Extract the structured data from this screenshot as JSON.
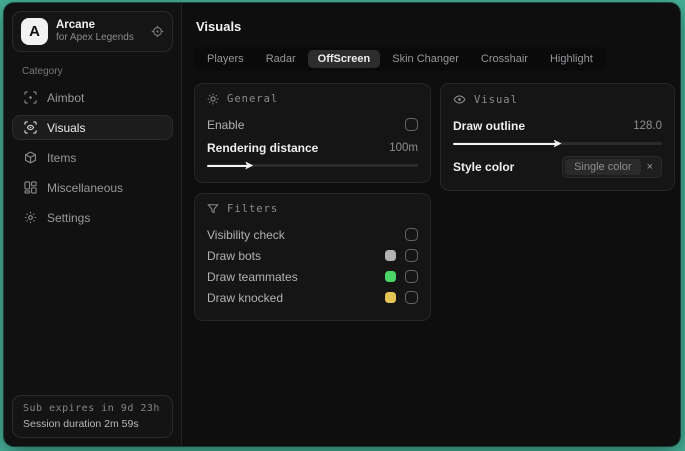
{
  "app": {
    "logo_letter": "A",
    "name": "Arcane",
    "subtitle": "for Apex Legends"
  },
  "sidebar": {
    "category_label": "Category",
    "items": [
      {
        "label": "Aimbot",
        "icon": "crosshair-scan-icon",
        "selected": false
      },
      {
        "label": "Visuals",
        "icon": "eye-scan-icon",
        "selected": true
      },
      {
        "label": "Items",
        "icon": "cube-icon",
        "selected": false
      },
      {
        "label": "Miscellaneous",
        "icon": "grid-icon",
        "selected": false
      },
      {
        "label": "Settings",
        "icon": "gear-icon",
        "selected": false
      }
    ],
    "status": {
      "sub_expires": "Sub expires in 9d 23h",
      "session_duration": "Session duration 2m 59s"
    }
  },
  "main": {
    "title": "Visuals",
    "tabs": [
      {
        "label": "Players",
        "selected": false
      },
      {
        "label": "Radar",
        "selected": false
      },
      {
        "label": "OffScreen",
        "selected": true
      },
      {
        "label": "Skin Changer",
        "selected": false
      },
      {
        "label": "Crosshair",
        "selected": false
      },
      {
        "label": "Highlight",
        "selected": false
      }
    ],
    "general": {
      "title": "General",
      "enable_label": "Enable",
      "rendering_distance_label": "Rendering distance",
      "rendering_distance_value": "100m",
      "rendering_distance_percent": 20
    },
    "visual": {
      "title": "Visual",
      "draw_outline_label": "Draw outline",
      "draw_outline_value": "128.0",
      "draw_outline_percent": 50,
      "style_color_label": "Style color",
      "style_color_chip": "Single color",
      "chip_close": "×"
    },
    "filters": {
      "title": "Filters",
      "rows": [
        {
          "label": "Visibility check",
          "swatch": null
        },
        {
          "label": "Draw bots",
          "swatch": "#b3b3b3"
        },
        {
          "label": "Draw teammates",
          "swatch": "#4bd567"
        },
        {
          "label": "Draw knocked",
          "swatch": "#e2c554"
        }
      ]
    }
  },
  "colors": {
    "desktop_background": "#47b299",
    "window_background": "#0e0e0f",
    "panel_background": "#151516",
    "accent_text": "#f2f2f2",
    "swatch_bots": "#b3b3b3",
    "swatch_teammates": "#4bd567",
    "swatch_knocked": "#e2c554"
  }
}
